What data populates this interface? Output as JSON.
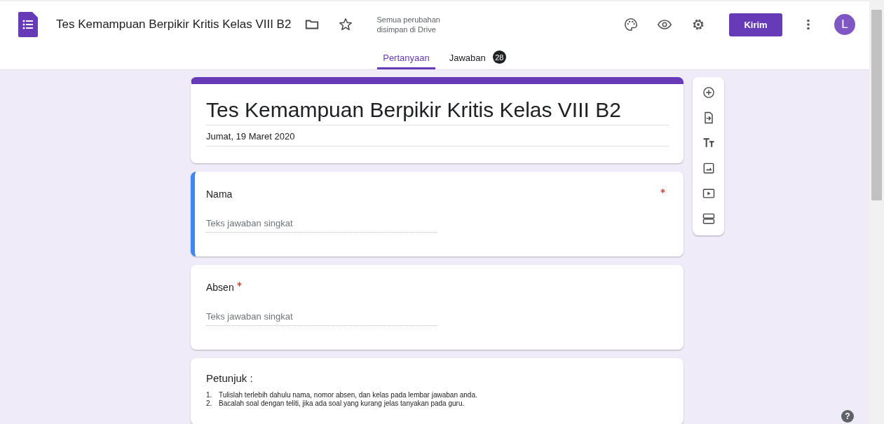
{
  "header": {
    "doc_title": "Tes Kemampuan Berpikir Kritis Kelas VIII B2",
    "save_status": "Semua perubahan disimpan di Drive",
    "send_button": "Kirim",
    "avatar": "L"
  },
  "tabs": [
    {
      "label": "Pertanyaan",
      "selected": true
    },
    {
      "label": "Jawaban",
      "selected": false,
      "count": "28"
    }
  ],
  "form": {
    "title": "Tes Kemampuan Berpikir Kritis Kelas VIII B2",
    "description": "Jumat, 19 Maret 2020",
    "selected": false
  },
  "items": [
    {
      "kind": "short_answer",
      "question": "Nama",
      "required": true,
      "placeholder": "Teks jawaban singkat",
      "selected": true
    },
    {
      "kind": "short_answer",
      "question": "Absen",
      "required": true,
      "placeholder": "Teks jawaban singkat",
      "selected": false
    },
    {
      "kind": "text",
      "title": "Petunjuk :",
      "lines": [
        {
          "number": "1.",
          "text": "Tulislah terlebih dahulu nama, nomor absen, dan kelas pada lembar jawaban anda."
        },
        {
          "number": "2.",
          "text": "Bacalah soal dengan teliti, jika ada soal yang kurang jelas tanyakan pada guru."
        }
      ],
      "selected": false
    }
  ],
  "help_button": "?"
}
